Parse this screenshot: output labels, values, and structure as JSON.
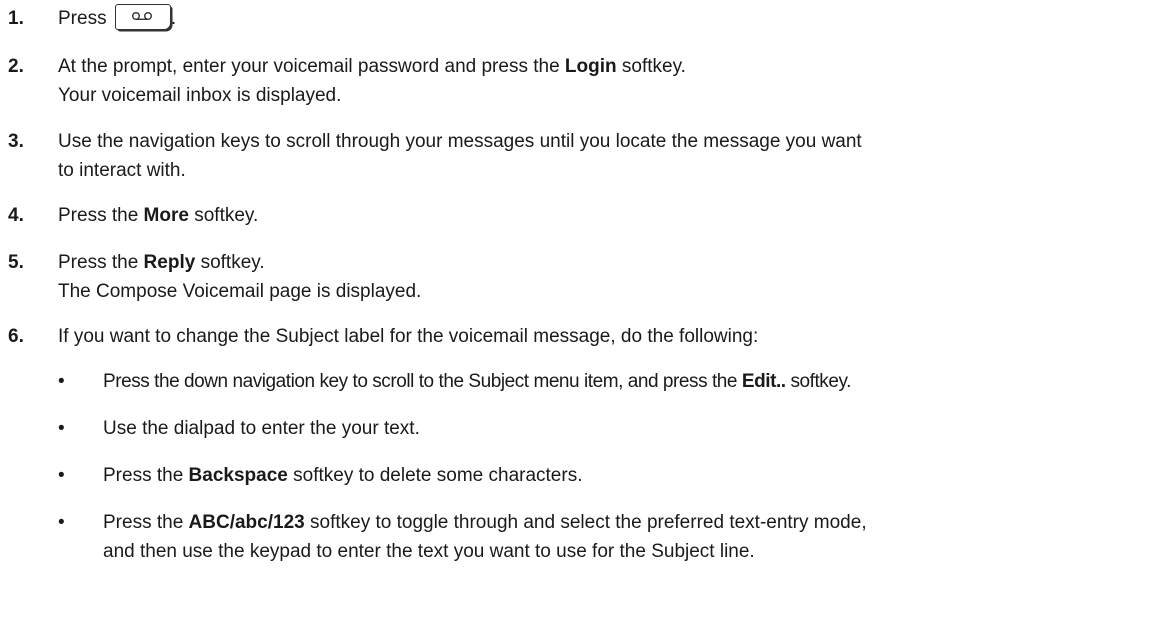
{
  "steps": [
    {
      "num": "1.",
      "pre": "Press",
      "post": "."
    },
    {
      "num": "2.",
      "line1_pre": "At the prompt, enter your voicemail password and press the ",
      "line1_bold": "Login",
      "line1_post": " softkey.",
      "line2": "Your voicemail inbox is displayed."
    },
    {
      "num": "3.",
      "line1": "Use the navigation keys to scroll through your messages until you locate the message you want",
      "line2": "to interact with."
    },
    {
      "num": "4.",
      "pre": "Press the ",
      "bold": "More",
      "post": " softkey."
    },
    {
      "num": "5.",
      "pre": "Press the ",
      "bold": "Reply",
      "post": " softkey.",
      "line2": "The Compose Voicemail page is displayed."
    },
    {
      "num": "6.",
      "text": "If you want to change the Subject label for the voicemail message, do the following:"
    }
  ],
  "bullets": [
    {
      "marker": "•",
      "pre": "Press the down navigation key to scroll to the Subject menu item, and press the ",
      "bold": "Edit..",
      "post": " softkey."
    },
    {
      "marker": "•",
      "text": "Use the dialpad to enter the your text."
    },
    {
      "marker": "•",
      "pre": "Press the ",
      "bold": "Backspace",
      "post": " softkey to delete some characters."
    },
    {
      "marker": "•",
      "pre": "Press the ",
      "bold": "ABC/abc/123",
      "post": " softkey to toggle through and select the preferred text-entry mode,",
      "line2": "and then use the keypad to enter the text you want to use for the Subject line."
    }
  ],
  "icons": {
    "step1_key": "voicemail-key-icon"
  }
}
